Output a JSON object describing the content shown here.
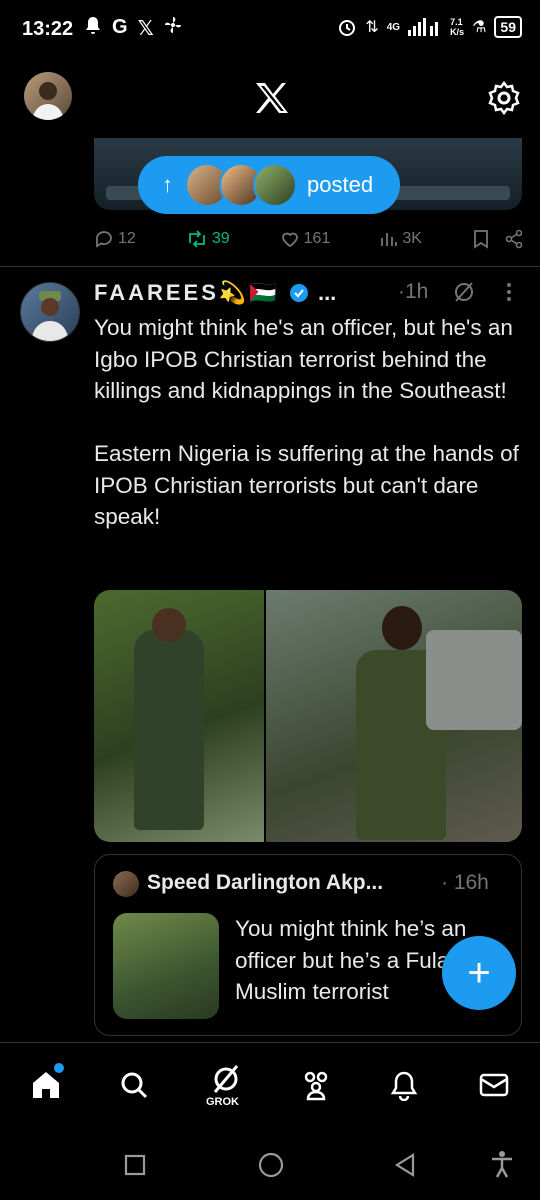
{
  "status_bar": {
    "time": "13:22",
    "left_icons": [
      "bell-icon",
      "G",
      "X",
      "fan-icon"
    ],
    "network": "4G",
    "speed_value": "7.1",
    "speed_unit": "K/s",
    "battery": "59"
  },
  "header": {
    "logo": "X"
  },
  "new_posts_pill": {
    "label": "posted"
  },
  "prev_post_actions": {
    "replies": "12",
    "reposts": "39",
    "likes": "161",
    "views": "3K"
  },
  "post": {
    "author_name": "FAAREES💫🇵🇸",
    "ellipsis": "...",
    "time": "·1h",
    "text": "You might think he's an officer, but he's an Igbo IPOB Christian terrorist behind the killings and kidnappings in the Southeast!\n\nEastern Nigeria is suffering at the hands of IPOB Christian terrorists but can't dare speak!"
  },
  "quote": {
    "author_name": "Speed Darlington Akp...",
    "time": "· 16h",
    "text": "You might think he’s an officer but he’s a Fulani Muslim terrorist"
  },
  "bottom_nav": {
    "grok_label": "GROK"
  },
  "colors": {
    "accent": "#1d9bf0",
    "repost": "#00ba7c",
    "muted": "#71767b"
  }
}
